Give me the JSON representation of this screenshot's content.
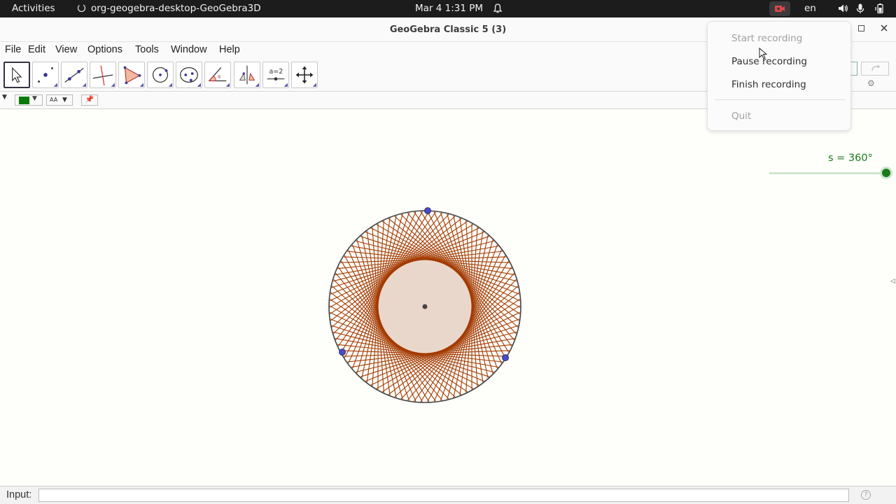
{
  "topbar": {
    "activities": "Activities",
    "app_name": "org-geogebra-desktop-GeoGebra3D",
    "clock": "Mar 4  1:31 PM",
    "language": "en",
    "icons": [
      "spinner-icon",
      "notification-bell-icon",
      "screen-recording-icon",
      "volume-icon",
      "microphone-icon",
      "battery-icon"
    ]
  },
  "window": {
    "title": "GeoGebra Classic 5 (3)"
  },
  "menubar": {
    "items": [
      "File",
      "Edit",
      "View",
      "Options",
      "Tools",
      "Window",
      "Help"
    ]
  },
  "toolbar": {
    "tools": [
      "move-tool",
      "point-tool",
      "line-tool",
      "perpendicular-line-tool",
      "polygon-tool",
      "circle-center-point-tool",
      "ellipse-tool",
      "angle-tool",
      "reflect-tool",
      "slider-tool",
      "move-graphics-view-tool"
    ],
    "slider_tool_label": "a=2"
  },
  "stylebar": {
    "color": "#0a7a0a",
    "text_style_label": "AA"
  },
  "graphics": {
    "slider_label": "s = 360°",
    "slider_value_fraction": 1.0,
    "accent_green": "#1a7a1a",
    "curve_color": "#a33a00",
    "fill_color": "#ead7cc",
    "point_color": "#4444cc"
  },
  "inputbar": {
    "label": "Input:",
    "value": "",
    "help_icon": "help-icon"
  },
  "recording_menu": {
    "items": [
      {
        "label": "Start recording",
        "enabled": false
      },
      {
        "label": "Pause recording",
        "enabled": true
      },
      {
        "label": "Finish recording",
        "enabled": true
      },
      {
        "label": "Quit",
        "enabled": false
      }
    ]
  }
}
